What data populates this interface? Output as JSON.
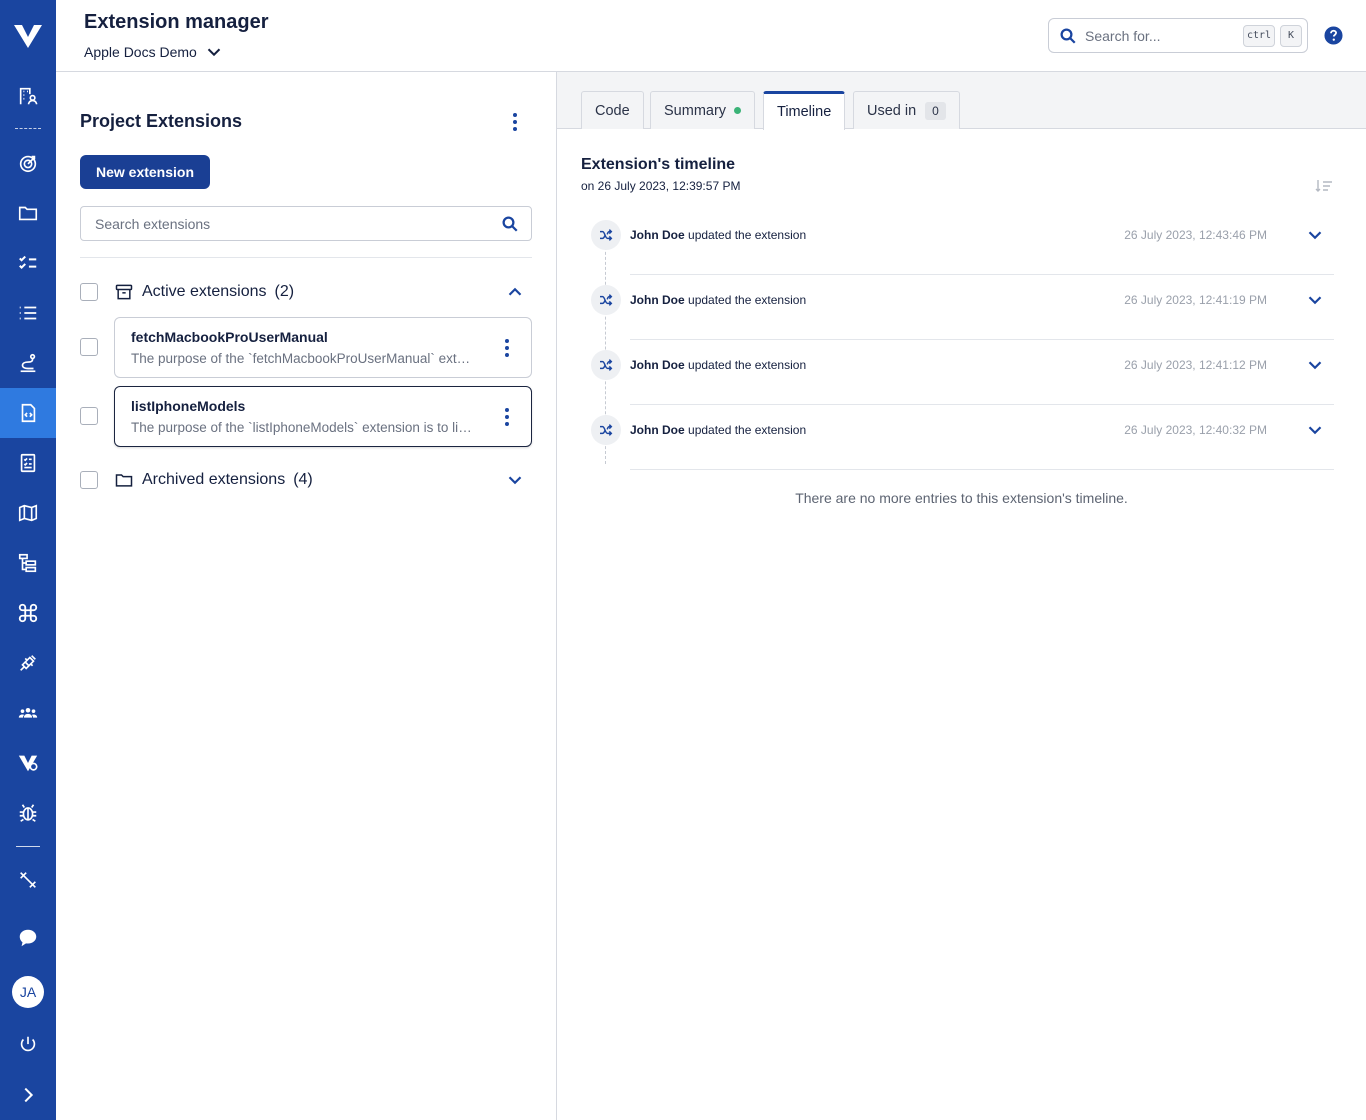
{
  "header": {
    "title": "Extension manager",
    "project": "Apple Docs Demo",
    "search_placeholder": "Search for...",
    "shortcut_key1": "ctrl",
    "shortcut_key2": "K"
  },
  "sidebar": {
    "avatar_initials": "JA",
    "items": [
      {
        "icon": "people-directory-icon"
      },
      {
        "icon": "target-icon"
      },
      {
        "icon": "folder-icon"
      },
      {
        "icon": "checklist-icon"
      },
      {
        "icon": "list-icon"
      },
      {
        "icon": "route-icon"
      },
      {
        "icon": "code-file-icon",
        "active": true
      },
      {
        "icon": "test-plan-icon"
      },
      {
        "icon": "map-icon"
      },
      {
        "icon": "hierarchy-icon"
      },
      {
        "icon": "command-icon"
      },
      {
        "icon": "plug-icon"
      },
      {
        "icon": "team-icon"
      },
      {
        "icon": "brand-settings-icon"
      },
      {
        "icon": "bug-icon"
      },
      {
        "icon": "satellite-icon"
      },
      {
        "icon": "chat-icon"
      },
      {
        "icon": "power-icon"
      },
      {
        "icon": "expand-icon"
      }
    ],
    "accent": "#1a45a0",
    "active_color": "#2f7ae0"
  },
  "left": {
    "title": "Project Extensions",
    "new_button": "New extension",
    "search_placeholder": "Search extensions",
    "active_group": {
      "label": "Active extensions",
      "count": "(2)"
    },
    "archived_group": {
      "label": "Archived extensions",
      "count": "(4)"
    },
    "extensions": [
      {
        "name": "fetchMacbookProUserManual",
        "description": "The purpose of the `fetchMacbookProUserManual` extension is to retrieve the user manual"
      },
      {
        "name": "listIphoneModels",
        "description": "The purpose of the `listIphoneModels` extension is to list all iPhone models"
      }
    ]
  },
  "right": {
    "tabs": [
      {
        "label": "Code"
      },
      {
        "label": "Summary"
      },
      {
        "label": "Timeline"
      },
      {
        "label": "Used in",
        "badge": "0"
      }
    ],
    "active_tab": "Timeline",
    "timeline_title": "Extension's timeline",
    "timeline_subtitle": "on 26 July 2023, 12:39:57 PM",
    "entries": [
      {
        "user": "John Doe",
        "action": "updated the extension",
        "timestamp": "26 July 2023, 12:43:46 PM"
      },
      {
        "user": "John Doe",
        "action": "updated the extension",
        "timestamp": "26 July 2023, 12:41:19 PM"
      },
      {
        "user": "John Doe",
        "action": "updated the extension",
        "timestamp": "26 July 2023, 12:41:12 PM"
      },
      {
        "user": "John Doe",
        "action": "updated the extension",
        "timestamp": "26 July 2023, 12:40:32 PM"
      }
    ],
    "end_message": "There are no more entries to this extension's timeline.",
    "status_color": "#3bb377"
  }
}
